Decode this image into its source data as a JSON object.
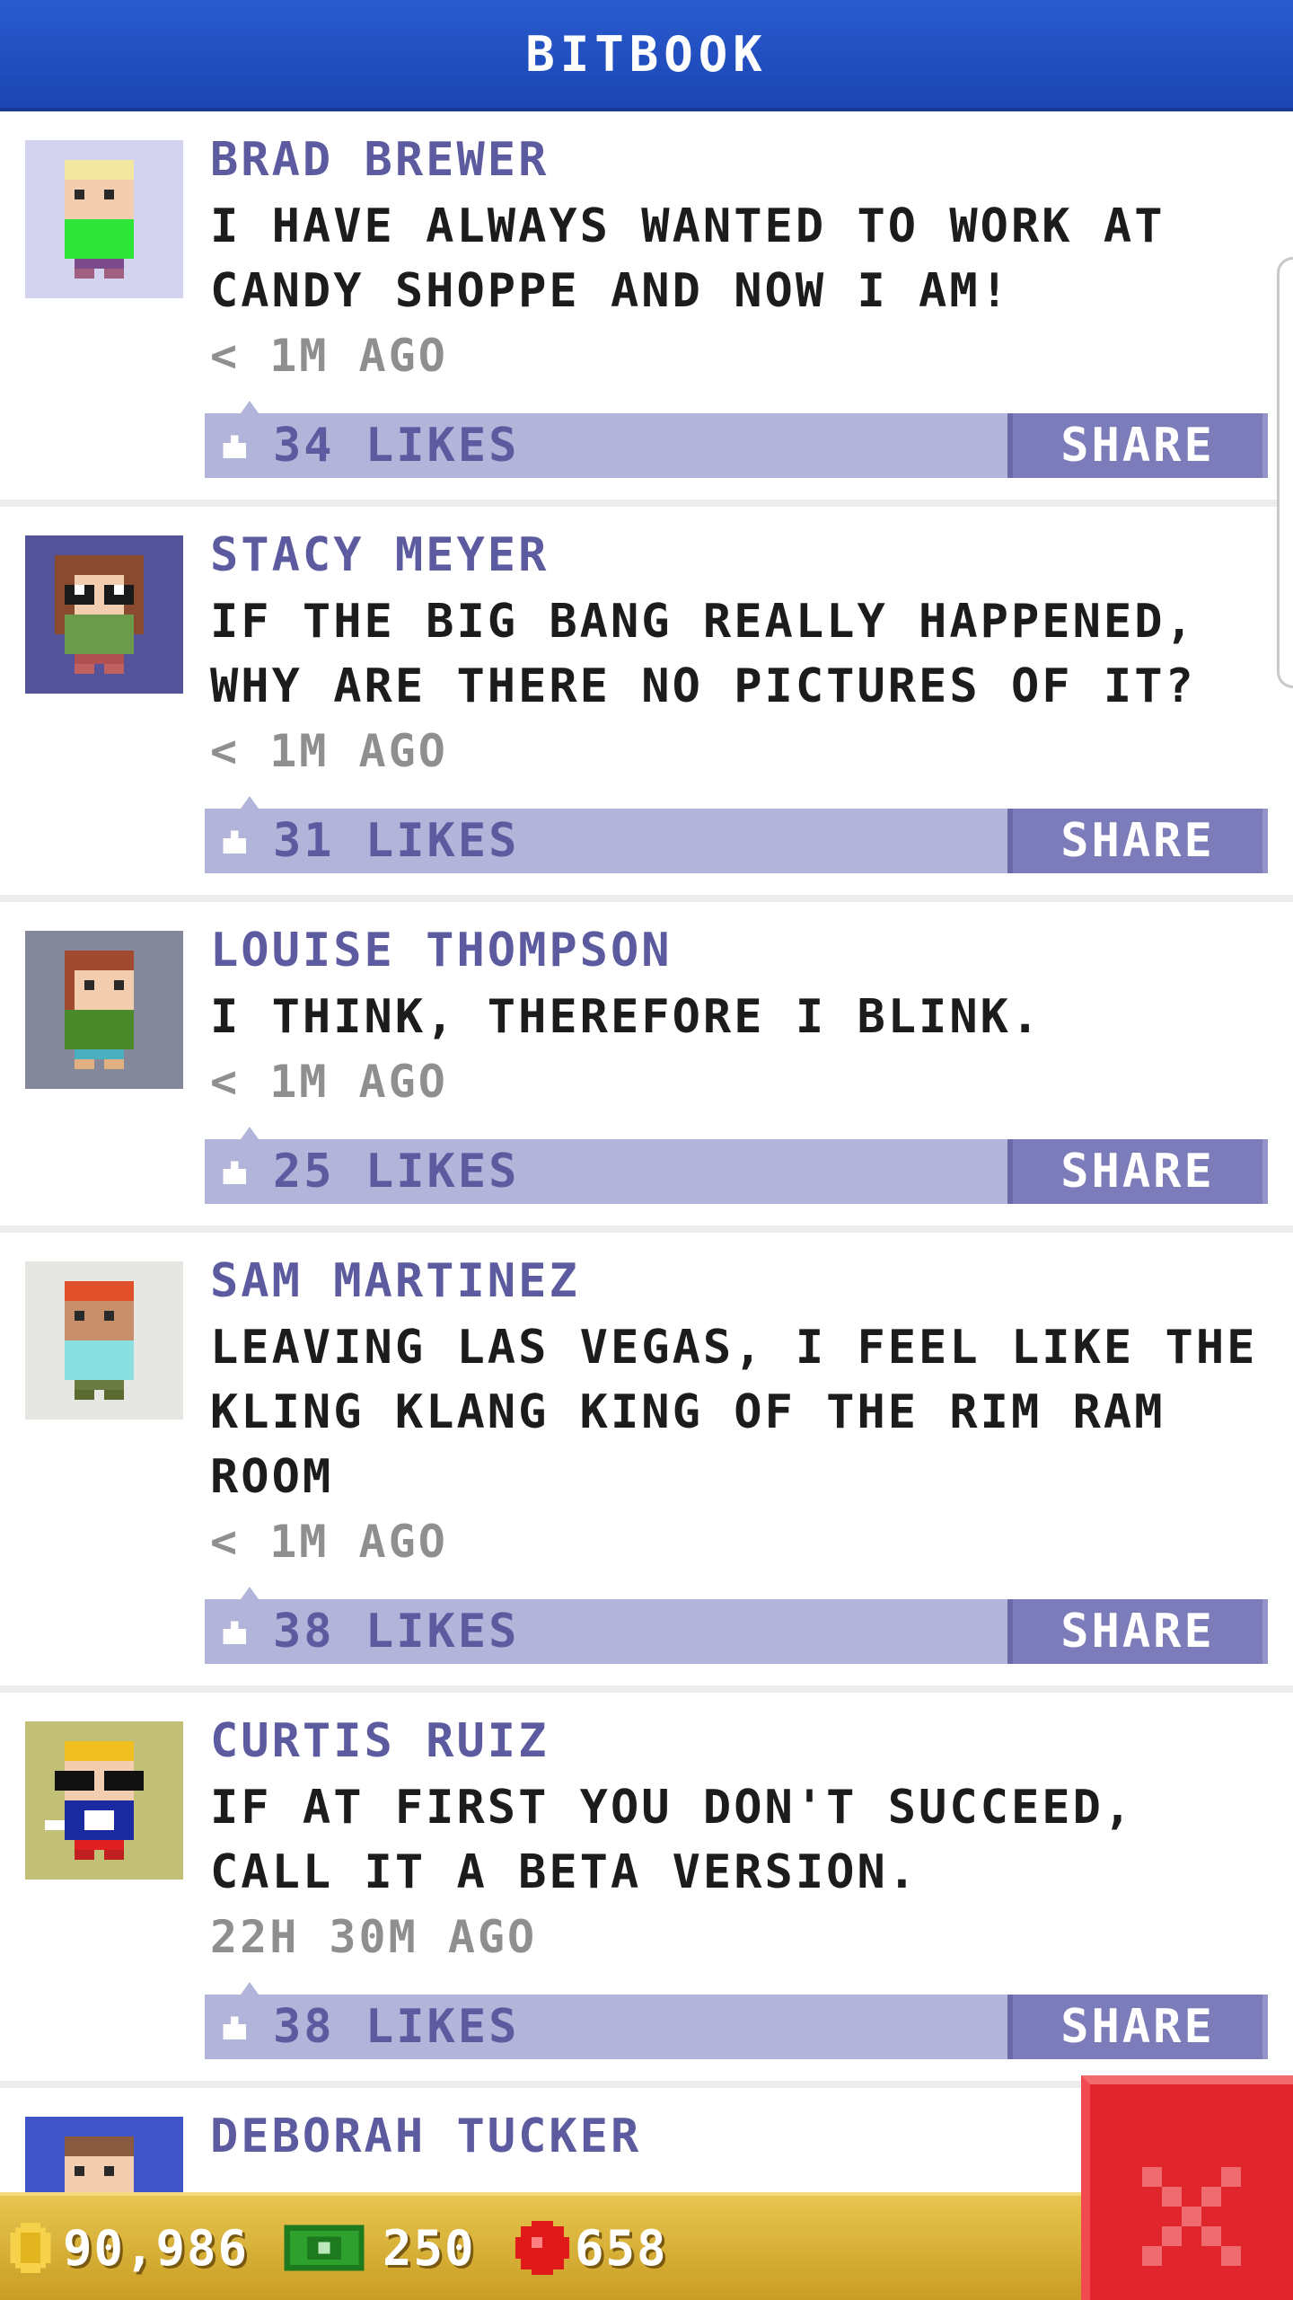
{
  "header": {
    "title": "BITBOOK"
  },
  "posts": [
    {
      "name": "BRAD BREWER",
      "text": "I HAVE ALWAYS WANTED TO WORK AT CANDY SHOPPE AND NOW I AM!",
      "time": "< 1M AGO",
      "likes": "34 LIKES",
      "share": "SHARE"
    },
    {
      "name": "STACY MEYER",
      "text": "IF THE BIG BANG REALLY HAPPENED, WHY ARE THERE NO PICTURES OF IT?",
      "time": "< 1M AGO",
      "likes": "31 LIKES",
      "share": "SHARE"
    },
    {
      "name": "LOUISE THOMPSON",
      "text": "I THINK, THEREFORE I BLINK.",
      "time": "< 1M AGO",
      "likes": "25 LIKES",
      "share": "SHARE"
    },
    {
      "name": "SAM MARTINEZ",
      "text": "LEAVING LAS VEGAS, I FEEL LIKE THE KLING KLANG KING OF THE RIM RAM ROOM",
      "time": "< 1M AGO",
      "likes": "38 LIKES",
      "share": "SHARE"
    },
    {
      "name": "CURTIS RUIZ",
      "text": "IF AT FIRST YOU DON'T SUCCEED, CALL IT A BETA VERSION.",
      "time": "22H 30M AGO",
      "likes": "38 LIKES",
      "share": "SHARE"
    },
    {
      "name": "DEBORAH TUCKER"
    }
  ],
  "currency": {
    "coins": "90,986",
    "bux": "250",
    "gems": "658"
  },
  "icons": {
    "like": "thumbs-up-icon",
    "close": "close-x-icon",
    "coin": "coin-icon",
    "bux": "bux-banknote-icon",
    "gem": "red-gem-icon"
  },
  "colors": {
    "header": "#1f4dbf",
    "name": "#5d5ba0",
    "like_bar": "#b2b4da",
    "share_button": "#7c7cba",
    "currency_bar": "#d8b23a",
    "close_button": "#e0262c"
  }
}
